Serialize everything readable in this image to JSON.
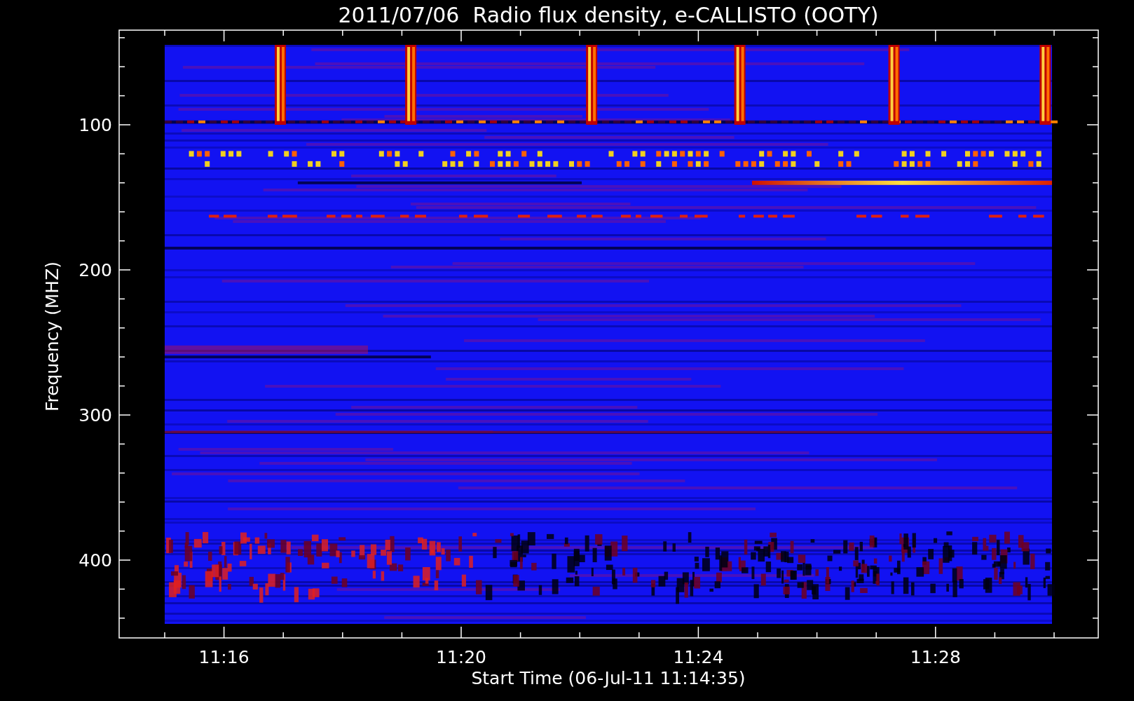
{
  "title": "2011/07/06  Radio flux density, e-CALLISTO (OOTY)",
  "x_axis": {
    "label": "Start Time (06-Jul-11 11:14:35)",
    "tick_labels": [
      "11:16",
      "11:20",
      "11:24",
      "11:28"
    ]
  },
  "y_axis": {
    "label": "Frequency (MHZ)",
    "tick_labels": [
      "100",
      "200",
      "300",
      "400"
    ]
  }
}
